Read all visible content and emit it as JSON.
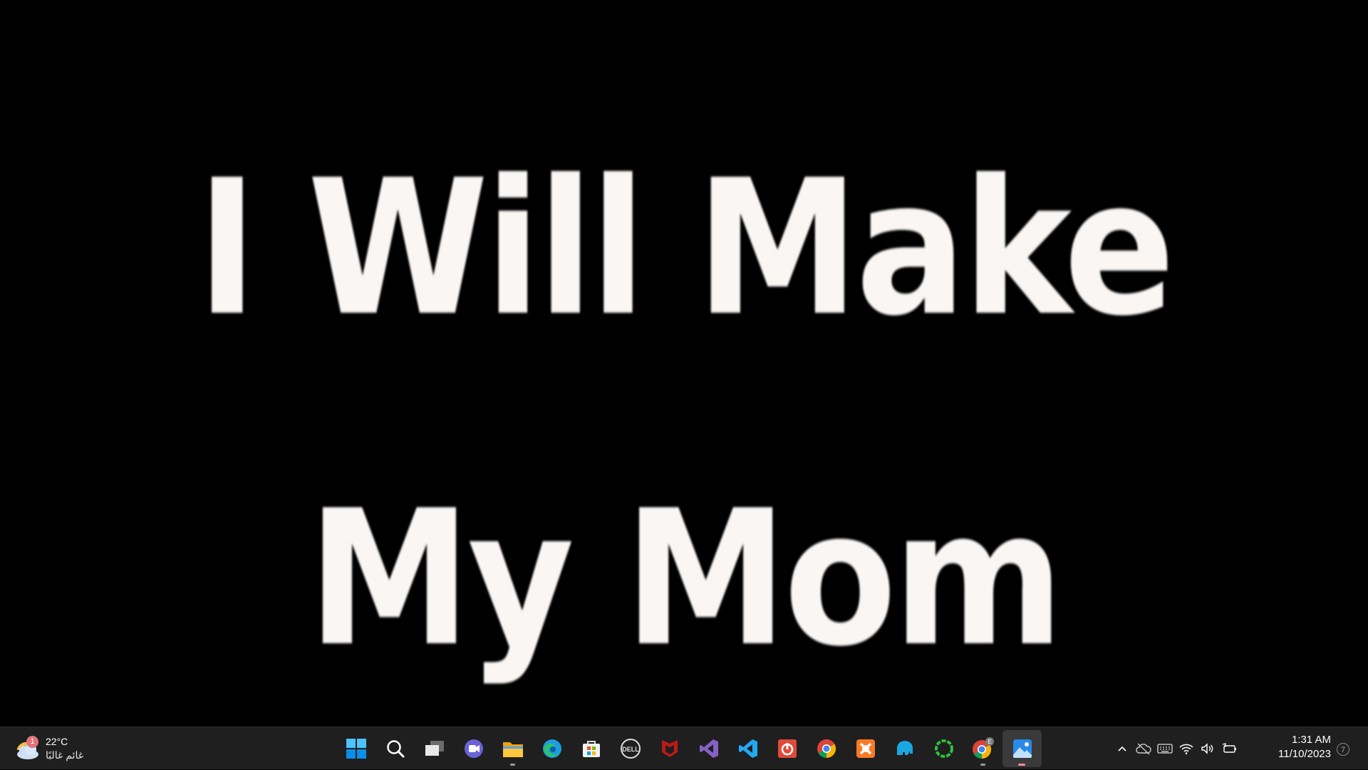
{
  "image_viewer": {
    "line1": "I Will Make",
    "line2": "My Mom"
  },
  "taskbar": {
    "weather": {
      "icon": "partly-cloudy-icon",
      "badge": "1",
      "temperature": "22°C",
      "condition": "غائم غالبًا"
    },
    "apps": [
      {
        "name": "start-button",
        "icon": "windows-logo"
      },
      {
        "name": "search-button",
        "icon": "search-icon"
      },
      {
        "name": "task-view-button",
        "icon": "task-view-icon"
      },
      {
        "name": "teams-chat-button",
        "icon": "teams-chat-icon"
      },
      {
        "name": "file-explorer-button",
        "icon": "folder-icon",
        "running": true
      },
      {
        "name": "edge-button",
        "icon": "edge-icon"
      },
      {
        "name": "microsoft-store-button",
        "icon": "store-icon"
      },
      {
        "name": "dell-button",
        "icon": "dell-icon"
      },
      {
        "name": "mcafee-button",
        "icon": "mcafee-icon"
      },
      {
        "name": "visual-studio-button",
        "icon": "visual-studio-icon"
      },
      {
        "name": "vscode-button",
        "icon": "vscode-icon"
      },
      {
        "name": "power-app-button",
        "icon": "power-icon"
      },
      {
        "name": "chrome-button",
        "icon": "chrome-icon"
      },
      {
        "name": "xampp-button",
        "icon": "xampp-icon"
      },
      {
        "name": "elephant-app-button",
        "icon": "elephant-icon"
      },
      {
        "name": "ring-app-button",
        "icon": "ring-icon"
      },
      {
        "name": "chrome-profile-button",
        "icon": "chrome-icon",
        "badge": "E",
        "running": true
      },
      {
        "name": "photos-button",
        "icon": "photos-icon",
        "running": true,
        "active": true
      }
    ],
    "tray": [
      "chevron-up-icon",
      "onedrive-offline-icon",
      "keyboard-icon",
      "wifi-icon",
      "volume-icon",
      "battery-charging-icon"
    ],
    "time": "1:31 AM",
    "date": "11/10/2023",
    "notification_count": "7"
  }
}
